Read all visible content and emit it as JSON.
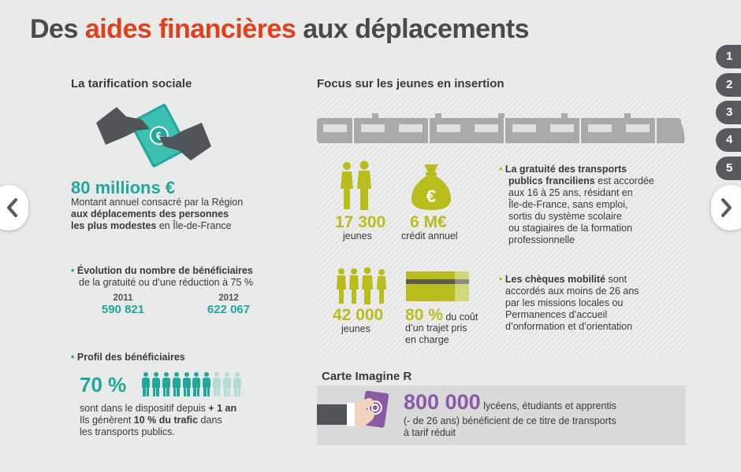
{
  "title": {
    "part1": "Des ",
    "accent": "aides financières",
    "part2": " aux déplacements"
  },
  "colors": {
    "accent": "#e2401b",
    "teal": "#22a79a",
    "olive": "#b8bd1c",
    "purple": "#8a5aa3",
    "dark_tab": "#555b5e"
  },
  "nav": {
    "pages": [
      "1",
      "2",
      "3",
      "4",
      "5"
    ],
    "prev_icon": "chevron-left-icon",
    "next_icon": "chevron-right-icon"
  },
  "tarification": {
    "heading": "La tarification sociale",
    "amount": "80 millions €",
    "desc_line1": "Montant annuel consacré par la Région",
    "desc_bold1": "aux déplacements des personnes",
    "desc_bold2": "les plus modestes",
    "desc_end": " en Île-de-France"
  },
  "evolution": {
    "bullet": "•",
    "title_line1": "Évolution du nombre de bénéficiaires",
    "title_line2": "de la gratuité ou d’une réduction à 75 %",
    "years": [
      {
        "year": "2011",
        "value": "590 821"
      },
      {
        "year": "2012",
        "value": "622 067"
      }
    ]
  },
  "profil": {
    "bullet": "•",
    "title": "Profil des bénéficiaires",
    "percent": "70 %",
    "people_filled": 7,
    "people_total": 10,
    "line1_pre": "sont dans le dispositif depuis ",
    "line1_bold": "+ 1 an",
    "line2_pre": "Ils génèrent ",
    "line2_bold": "10 % du trafic",
    "line2_post": " dans",
    "line3": "les transports publics."
  },
  "focus": {
    "heading": "Focus sur les jeunes en insertion",
    "stat1_value": "17 300",
    "stat1_label": "jeunes",
    "stat2_value": "6 M€",
    "stat2_label": "crédit annuel",
    "stat3_value": "42 000",
    "stat3_label": "jeunes",
    "stat4_value": "80 %",
    "stat4_suffix": " du coût",
    "stat4_line2": "d’un trajet pris",
    "stat4_line3": "en charge",
    "gratuite_bold1": "La gratuité des transports",
    "gratuite_bold2": "publics franciliens",
    "gratuite_rest1": " est accordée",
    "gratuite_rest2": "aux 16 à 25 ans, résidant en",
    "gratuite_rest3": "Île-de-France, sans emploi,",
    "gratuite_rest4": "sortis du système scolaire",
    "gratuite_rest5": "ou stagiaires de la formation",
    "gratuite_rest6": "professionnelle",
    "cheques_bold": "Les chèques mobilité",
    "cheques_rest1": " sont",
    "cheques_rest2": "accordés aux moins de 26 ans",
    "cheques_rest3": "par les missions locales ou",
    "cheques_rest4": "Permanences d’accueil",
    "cheques_rest5": "d’onformation et d’orientation"
  },
  "imagine": {
    "heading": "Carte Imagine R",
    "value": "800 000",
    "line1": " lycéens, étudiants et apprentis",
    "line2": "(- de 26 ans) bénéficient de ce titre de transports",
    "line3": "à tarif réduit"
  }
}
